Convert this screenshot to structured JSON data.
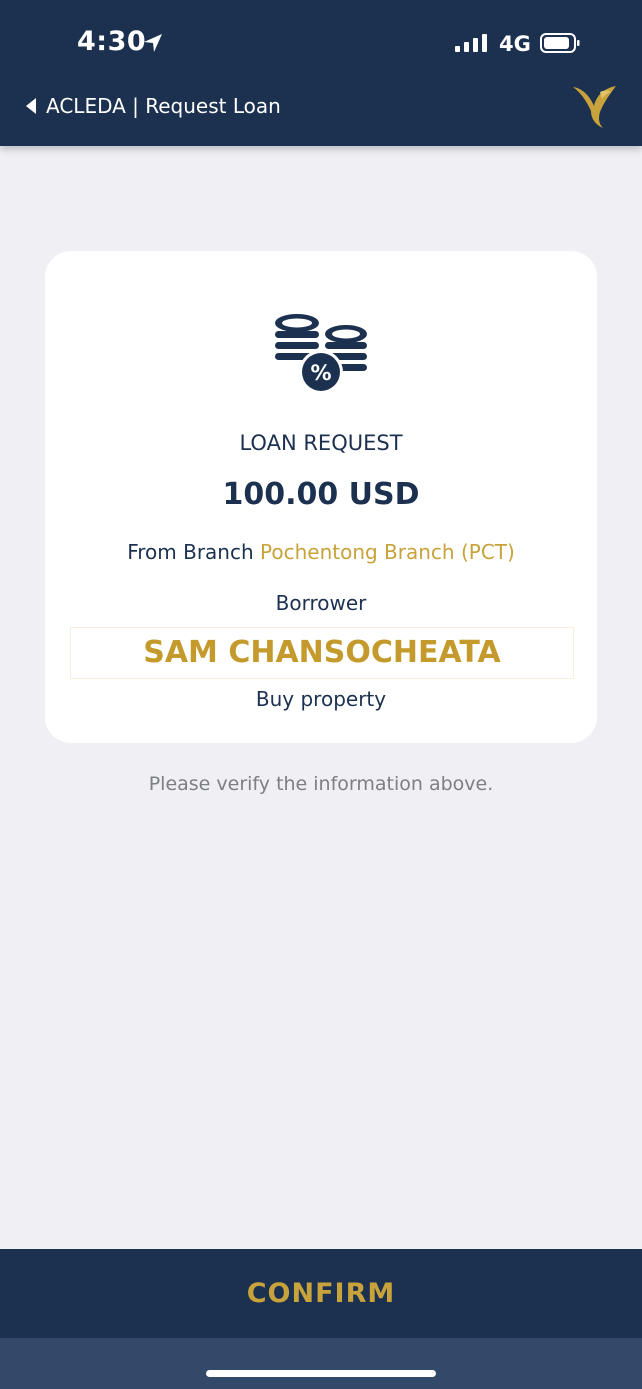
{
  "status_bar": {
    "time": "4:30",
    "network": "4G"
  },
  "nav": {
    "title": "ACLEDA | Request Loan"
  },
  "card": {
    "icon": "coins-percent-icon",
    "label": "LOAN REQUEST",
    "amount": "100.00 USD",
    "branch_prefix": "From Branch",
    "branch_name": "Pochentong Branch (PCT)",
    "borrower_label": "Borrower",
    "borrower_name": "SAM CHANSOCHEATA",
    "purpose": "Buy property"
  },
  "verify_text": "Please verify the information above.",
  "confirm_label": "CONFIRM",
  "colors": {
    "navy": "#1c3150",
    "gold": "#c8a23a",
    "background": "#efeff4"
  }
}
